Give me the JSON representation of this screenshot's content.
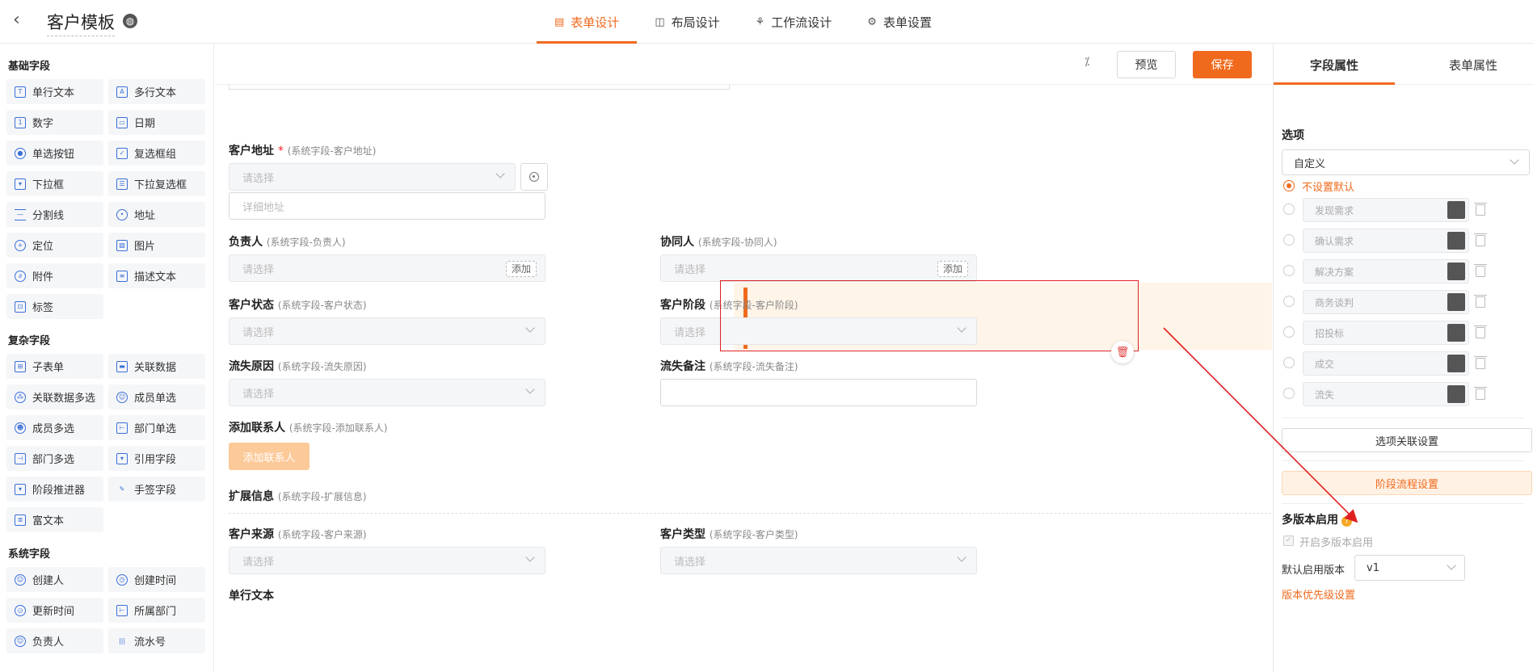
{
  "header": {
    "title": "客户模板",
    "tabs": [
      {
        "label": "表单设计",
        "icon": "form-icon",
        "active": true
      },
      {
        "label": "布局设计",
        "icon": "layout-icon",
        "active": false
      },
      {
        "label": "工作流设计",
        "icon": "workflow-icon",
        "active": false
      },
      {
        "label": "表单设置",
        "icon": "settings-icon",
        "active": false
      }
    ]
  },
  "palette": {
    "groups": [
      {
        "title": "基础字段",
        "items": [
          "单行文本",
          "多行文本",
          "数字",
          "日期",
          "单选按钮",
          "复选框组",
          "下拉框",
          "下拉复选框",
          "分割线",
          "地址",
          "定位",
          "图片",
          "附件",
          "描述文本",
          "标签"
        ]
      },
      {
        "title": "复杂字段",
        "items": [
          "子表单",
          "关联数据",
          "关联数据多选",
          "成员单选",
          "成员多选",
          "部门单选",
          "部门多选",
          "引用字段",
          "阶段推进器",
          "手签字段",
          "富文本"
        ]
      },
      {
        "title": "系统字段",
        "items": [
          "创建人",
          "创建时间",
          "更新时间",
          "所属部门",
          "负责人",
          "流水号"
        ]
      }
    ]
  },
  "toolbar": {
    "preview_label": "预览",
    "save_label": "保存"
  },
  "form": {
    "address": {
      "label": "客户地址",
      "required_mark": "*",
      "sys": "(系统字段-客户地址)",
      "placeholder": "请选择",
      "detail_placeholder": "详细地址"
    },
    "owner": {
      "label": "负责人",
      "sys": "(系统字段-负责人)",
      "placeholder": "请选择",
      "add": "添加"
    },
    "collab": {
      "label": "协同人",
      "sys": "(系统字段-协同人)",
      "placeholder": "请选择",
      "add": "添加"
    },
    "status": {
      "label": "客户状态",
      "sys": "(系统字段-客户状态)",
      "placeholder": "请选择"
    },
    "stage": {
      "label": "客户阶段",
      "sys": "(系统字段-客户阶段)",
      "placeholder": "请选择"
    },
    "lost_reason": {
      "label": "流失原因",
      "sys": "(系统字段-流失原因)",
      "placeholder": "请选择"
    },
    "lost_note": {
      "label": "流失备注",
      "sys": "(系统字段-流失备注)"
    },
    "contact": {
      "label": "添加联系人",
      "sys": "(系统字段-添加联系人)",
      "button": "添加联系人"
    },
    "ext": {
      "label": "扩展信息",
      "sys": "(系统字段-扩展信息)"
    },
    "source": {
      "label": "客户来源",
      "sys": "(系统字段-客户来源)",
      "placeholder": "请选择"
    },
    "type": {
      "label": "客户类型",
      "sys": "(系统字段-客户类型)",
      "placeholder": "请选择"
    },
    "single_text": {
      "label": "单行文本"
    }
  },
  "props": {
    "tabs": [
      "字段属性",
      "表单属性"
    ],
    "options_title": "选项",
    "options_source": "自定义",
    "no_default": "不设置默认",
    "options": [
      "发现需求",
      "确认需求",
      "解决方案",
      "商务谈判",
      "招投标",
      "成交",
      "流失"
    ],
    "option_color": "#555555",
    "link_settings": "选项关联设置",
    "stage_settings": "阶段流程设置",
    "multi_version_title": "多版本启用",
    "multi_version_checkbox": "开启多版本启用",
    "default_version_label": "默认启用版本",
    "default_version_value": "v1",
    "version_priority": "版本优先级设置"
  },
  "colors": {
    "accent": "#f06a1e",
    "annotation": "#e02020"
  }
}
